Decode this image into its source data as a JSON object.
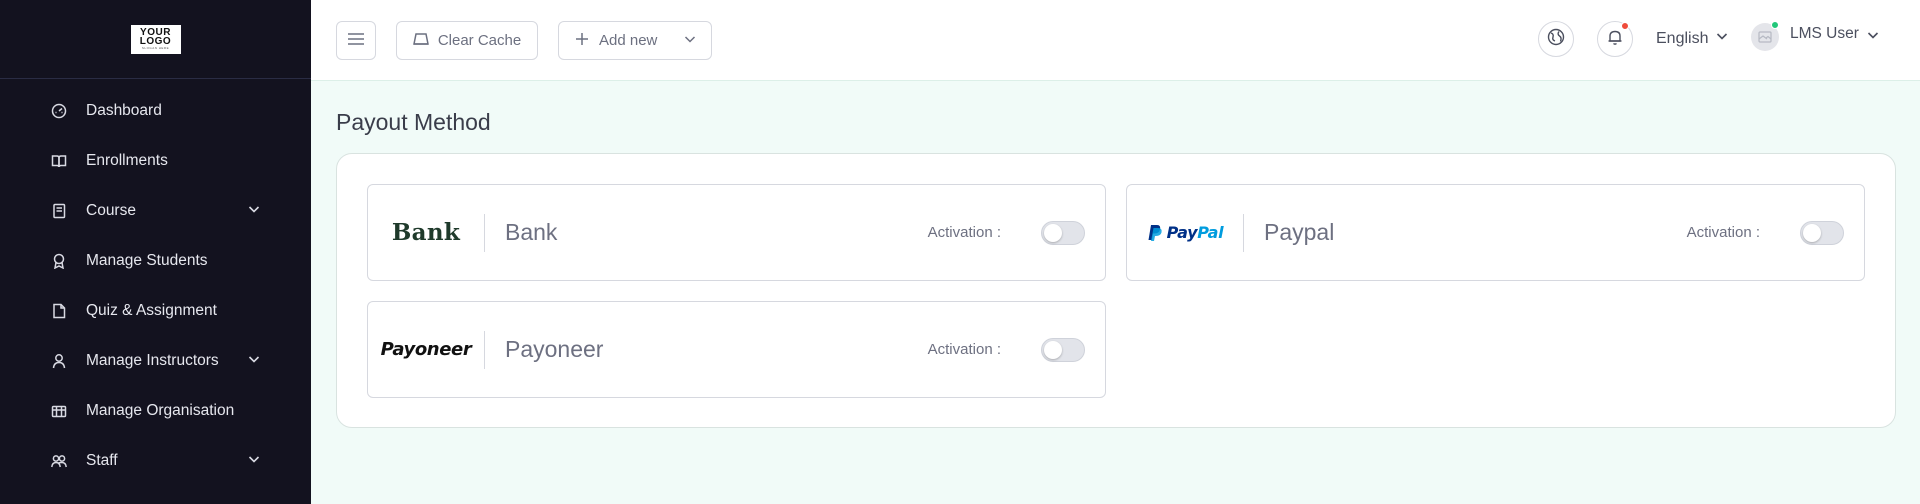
{
  "brand": {
    "logo_line1": "YOUR",
    "logo_line2": "LOGO",
    "logo_tagline": "SLOGAN HERE"
  },
  "sidebar": {
    "items": [
      {
        "label": "Dashboard",
        "icon": "gauge-icon",
        "has_submenu": false
      },
      {
        "label": "Enrollments",
        "icon": "open-book-icon",
        "has_submenu": false
      },
      {
        "label": "Course",
        "icon": "book-icon",
        "has_submenu": true
      },
      {
        "label": "Manage Students",
        "icon": "award-icon",
        "has_submenu": false
      },
      {
        "label": "Quiz & Assignment",
        "icon": "file-icon",
        "has_submenu": false
      },
      {
        "label": "Manage Instructors",
        "icon": "user-icon",
        "has_submenu": true
      },
      {
        "label": "Manage Organisation",
        "icon": "building-icon",
        "has_submenu": false
      },
      {
        "label": "Staff",
        "icon": "users-icon",
        "has_submenu": true
      }
    ]
  },
  "header": {
    "clear_cache_label": "Clear Cache",
    "add_new_label": "Add new",
    "language": "English",
    "user_name": "LMS User",
    "notification_dot_color": "#ef4b3b",
    "online_dot_color": "#22c77a"
  },
  "main": {
    "page_title": "Payout Method",
    "methods": [
      {
        "name": "Bank",
        "logo_text": "Bank",
        "activation_label": "Activation :",
        "active": false
      },
      {
        "name": "Paypal",
        "logo_text_1": "Pay",
        "logo_text_2": "Pal",
        "activation_label": "Activation :",
        "active": false
      },
      {
        "name": "Payoneer",
        "logo_text": "Payoneer",
        "activation_label": "Activation :",
        "active": false
      }
    ]
  },
  "colors": {
    "sidebar_bg": "#13121f",
    "page_bg": "#f1fbf8",
    "paypal_dark": "#003087",
    "paypal_light": "#009cde"
  }
}
